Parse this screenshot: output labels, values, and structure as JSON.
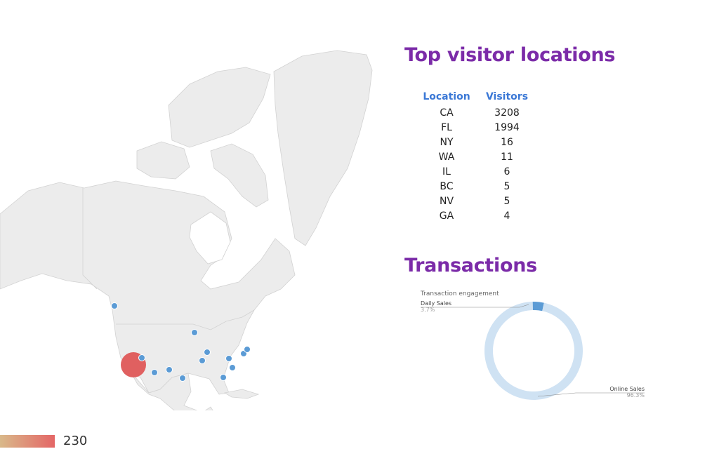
{
  "visitor_locations": {
    "title": "Top visitor locations",
    "columns": [
      "Location",
      "Visitors"
    ],
    "rows": [
      {
        "location": "CA",
        "visitors": "3208"
      },
      {
        "location": "FL",
        "visitors": "1994"
      },
      {
        "location": "NY",
        "visitors": "16"
      },
      {
        "location": "WA",
        "visitors": "11"
      },
      {
        "location": "IL",
        "visitors": "6"
      },
      {
        "location": "BC",
        "visitors": "5"
      },
      {
        "location": "NV",
        "visitors": "5"
      },
      {
        "location": "GA",
        "visitors": "4"
      }
    ]
  },
  "map": {
    "legend_max": "230",
    "colors": {
      "land": "#ececec",
      "border": "#d2d2d2",
      "marker": "#5b9bd5",
      "hotspot": "#e06060"
    }
  },
  "transactions": {
    "title": "Transactions",
    "chart_title": "Transaction engagement",
    "slices": [
      {
        "label": "Daily Sales",
        "percent_label": "3.7%",
        "value": 3.7,
        "color": "#5b9bd5"
      },
      {
        "label": "Online Sales",
        "percent_label": "96.3%",
        "value": 96.3,
        "color": "#cfe2f3"
      }
    ]
  },
  "colors": {
    "heading": "#7b2ba8",
    "table_header": "#3b78d6"
  }
}
